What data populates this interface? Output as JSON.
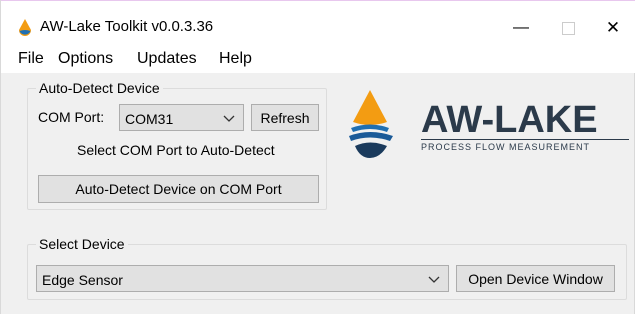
{
  "window": {
    "title": "AW-Lake Toolkit v0.0.3.36",
    "minimize_glyph": "—",
    "close_glyph": "✕",
    "icon": "aw-lake-drop-icon"
  },
  "menu": {
    "items": [
      {
        "label": "File"
      },
      {
        "label": "Options"
      },
      {
        "label": "Updates"
      },
      {
        "label": "Help"
      }
    ]
  },
  "auto_detect": {
    "group_title": "Auto-Detect Device",
    "com_port_label": "COM Port:",
    "com_port_value": "COM31",
    "refresh_label": "Refresh",
    "hint": "Select COM Port to Auto-Detect",
    "detect_button_label": "Auto-Detect Device on COM Port"
  },
  "logo": {
    "name": "AW-LAKE",
    "tagline": "PROCESS FLOW MEASUREMENT",
    "colors": {
      "orange": "#f39c12",
      "blue": "#1f6fb2",
      "navy": "#1a3a5c",
      "text": "#2b3a4a"
    }
  },
  "select_device": {
    "group_title": "Select Device",
    "device_value": "Edge Sensor",
    "open_button_label": "Open Device Window"
  }
}
